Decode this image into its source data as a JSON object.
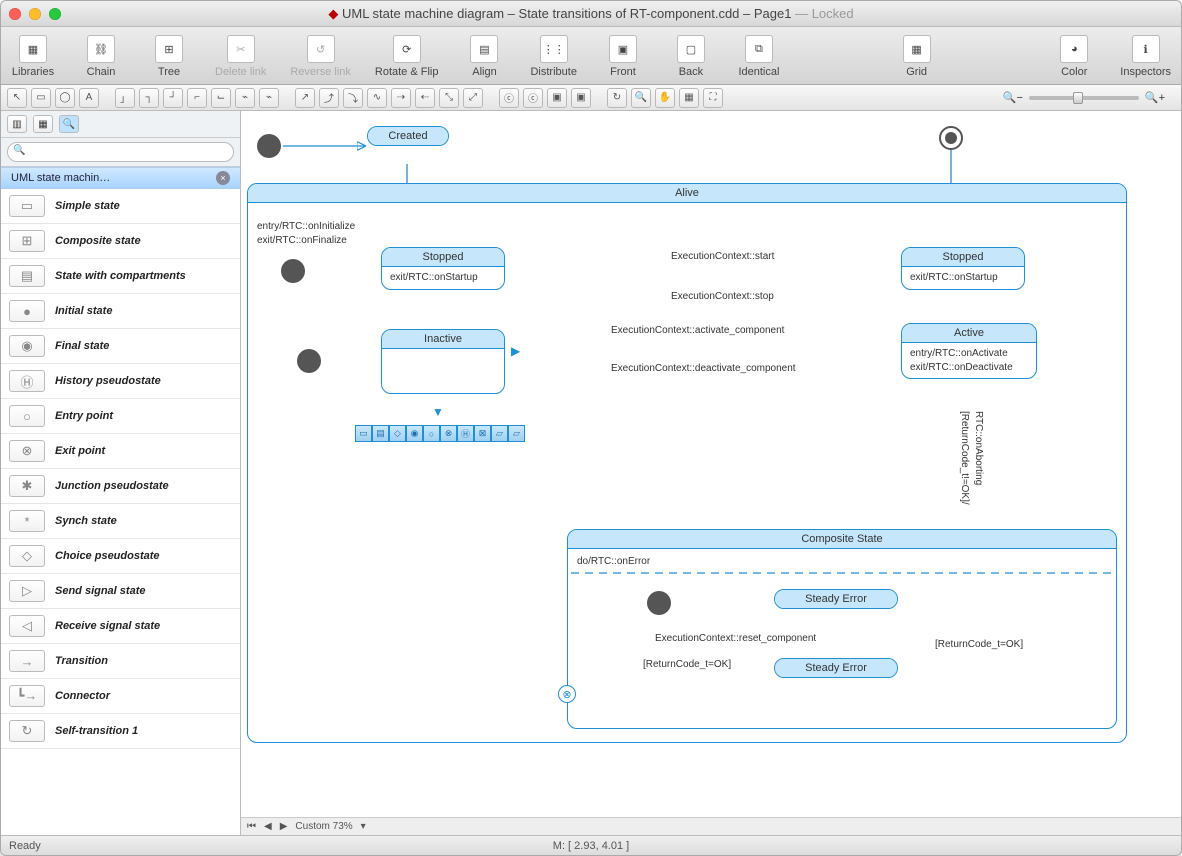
{
  "title": {
    "icon": "◆",
    "name": "UML state machine diagram – State transitions of RT-component.cdd – Page1",
    "locked": "— Locked"
  },
  "toolbar": [
    {
      "name": "libraries-button",
      "label": "Libraries",
      "glyph": "▦"
    },
    {
      "name": "chain-button",
      "label": "Chain",
      "glyph": "⛓"
    },
    {
      "name": "tree-button",
      "label": "Tree",
      "glyph": "⊞"
    },
    {
      "name": "delete-link-button",
      "label": "Delete link",
      "glyph": "✂",
      "disabled": true
    },
    {
      "name": "reverse-link-button",
      "label": "Reverse link",
      "glyph": "↺",
      "disabled": true
    },
    {
      "name": "rotate-flip-button",
      "label": "Rotate & Flip",
      "glyph": "⟳"
    },
    {
      "name": "align-button",
      "label": "Align",
      "glyph": "▤"
    },
    {
      "name": "distribute-button",
      "label": "Distribute",
      "glyph": "⋮⋮"
    },
    {
      "name": "front-button",
      "label": "Front",
      "glyph": "▣"
    },
    {
      "name": "back-button",
      "label": "Back",
      "glyph": "▢"
    },
    {
      "name": "identical-button",
      "label": "Identical",
      "glyph": "⧉"
    },
    {
      "name": "spacer"
    },
    {
      "name": "grid-button",
      "label": "Grid",
      "glyph": "▦"
    },
    {
      "name": "spacer"
    },
    {
      "name": "color-button",
      "label": "Color",
      "glyph": "◕"
    },
    {
      "name": "inspectors-button",
      "label": "Inspectors",
      "glyph": "ℹ"
    }
  ],
  "ribbon_groups": [
    [
      "↖",
      "▭",
      "◯",
      "A"
    ],
    [
      "」",
      "┐",
      "┘",
      "⌐",
      "⌙",
      "⌁",
      "⌁"
    ],
    [
      "↗",
      "⤴",
      "⤵",
      "∿",
      "⇢",
      "⇠",
      "⤡",
      "⤢"
    ],
    [
      "ⓒ",
      "ⓒ",
      "▣",
      "▣"
    ],
    [
      "↻",
      "🔍",
      "✋",
      "▦",
      "⛶"
    ]
  ],
  "sidebar": {
    "category": "UML state machin…",
    "search_placeholder": "",
    "items": [
      {
        "label": "Simple state",
        "glyph": "▭"
      },
      {
        "label": "Composite state",
        "glyph": "⊞"
      },
      {
        "label": "State with compartments",
        "glyph": "▤"
      },
      {
        "label": "Initial state",
        "glyph": "●"
      },
      {
        "label": "Final state",
        "glyph": "◉"
      },
      {
        "label": "History pseudostate",
        "glyph": "Ⓗ"
      },
      {
        "label": "Entry point",
        "glyph": "○"
      },
      {
        "label": "Exit point",
        "glyph": "⊗"
      },
      {
        "label": "Junction pseudostate",
        "glyph": "✱"
      },
      {
        "label": "Synch state",
        "glyph": "*"
      },
      {
        "label": "Choice pseudostate",
        "glyph": "◇"
      },
      {
        "label": "Send signal state",
        "glyph": "▷"
      },
      {
        "label": "Receive signal state",
        "glyph": "◁"
      },
      {
        "label": "Transition",
        "glyph": "→"
      },
      {
        "label": "Connector",
        "glyph": "┗→"
      },
      {
        "label": "Self-transition 1",
        "glyph": "↻"
      }
    ]
  },
  "diagram": {
    "states": {
      "created": {
        "title": "Created"
      },
      "alive": {
        "title": "Alive",
        "entry": "entry/RTC::onInitialize",
        "exit": "exit/RTC::onFinalize"
      },
      "stopped1": {
        "title": "Stopped",
        "body": "exit/RTC::onStartup"
      },
      "stopped2": {
        "title": "Stopped",
        "body": "exit/RTC::onStartup"
      },
      "inactive": {
        "title": "Inactive"
      },
      "active": {
        "title": "Active",
        "entry": "entry/RTC::onActivate",
        "exit": "exit/RTC::onDeactivate"
      },
      "composite": {
        "title": "Composite State",
        "do": "do/RTC::onError"
      },
      "steady1": {
        "title": "Steady Error"
      },
      "steady2": {
        "title": "Steady Error"
      }
    },
    "labels": {
      "ec_start": "ExecutionContext::start",
      "ec_stop": "ExecutionContext::stop",
      "ec_activate": "ExecutionContext::activate_component",
      "ec_deactivate": "ExecutionContext::deactivate_component",
      "ec_reset": "ExecutionContext::reset_component",
      "rc_ok1": "[ReturnCode_t=OK]",
      "rc_ok2": "[ReturnCode_t=OK]",
      "rc_notok": "[ReturnCode_t!=OK]/",
      "onaborting": "RTC::onAborting"
    }
  },
  "status": {
    "ready": "Ready",
    "mouse": "M: [ 2.93, 4.01 ]",
    "zoom": "Custom 73%"
  }
}
